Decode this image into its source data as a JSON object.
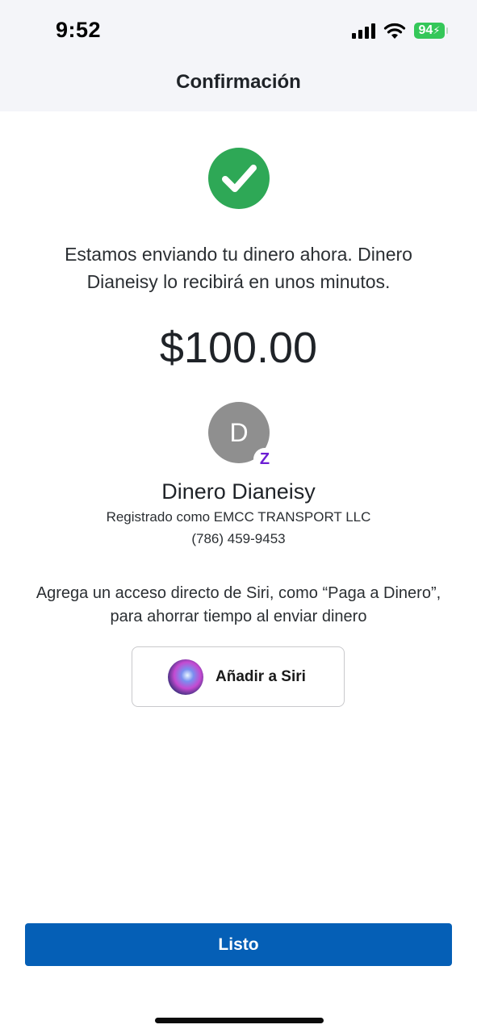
{
  "status_bar": {
    "time": "9:52",
    "battery": "94",
    "icons": [
      "signal-icon",
      "wifi-icon",
      "battery-charging-icon"
    ]
  },
  "header": {
    "title": "Confirmación"
  },
  "confirmation": {
    "icon": "checkmark-circle-icon",
    "message": "Estamos enviando tu dinero ahora. Dinero Dianeisy lo recibirá en unos minutos.",
    "amount": "$100.00"
  },
  "recipient": {
    "initial": "D",
    "badge_icon": "zelle-icon",
    "badge_glyph": "Z",
    "name": "Dinero Dianeisy",
    "registered_as": "Registrado como EMCC TRANSPORT LLC",
    "phone": "(786) 459-9453"
  },
  "siri": {
    "prompt": "Agrega un acceso directo de Siri, como “Paga a Dinero”, para ahorrar tiempo al enviar dinero",
    "button_label": "Añadir a Siri",
    "icon": "siri-icon"
  },
  "footer": {
    "done_label": "Listo"
  },
  "colors": {
    "success": "#2ea856",
    "primary": "#055fb6",
    "zelle": "#6d1ed4",
    "battery": "#34c759",
    "header_bg": "#f4f5f9"
  }
}
